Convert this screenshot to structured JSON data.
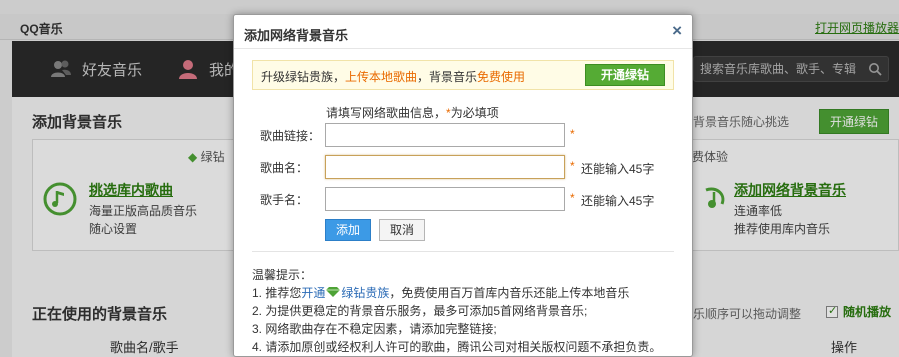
{
  "app": {
    "title": "QQ音乐",
    "open_web_link": "打开网页播放器"
  },
  "nav": {
    "friends": "好友音乐",
    "mine": "我的",
    "search_placeholder": "搜索音乐库歌曲、歌手、专辑"
  },
  "main": {
    "section_title": "添加背景音乐",
    "section_tip": "乐，背景音乐随心挑选",
    "open_green_small": "开通绿钻",
    "card_left": {
      "ribbon": "绿钻",
      "heading": "挑选库内歌曲",
      "line1": "海量正版高品质音乐",
      "line2": "随心设置"
    },
    "card_right": {
      "ribbon": "费体验",
      "heading": "添加网络背景音乐",
      "line1": "连通率低",
      "line2": "推荐使用库内音乐"
    },
    "section_title_2": "正在使用的背景音乐",
    "drag_tip": "乐顺序可以拖动调整",
    "random_play": "随机播放",
    "col_name": "歌曲名/歌手",
    "col_op": "操作"
  },
  "dialog": {
    "title": "添加网络背景音乐",
    "close": "×",
    "promo": {
      "part1": "升级绿钻贵族，",
      "part2": "上传本地歌曲",
      "part3": "，背景音乐",
      "part4": "免费使用",
      "button": "开通绿钻"
    },
    "form": {
      "intro_prefix": "请填写网络歌曲信息，",
      "intro_star": "*",
      "intro_suffix": "为必填项",
      "link_label": "歌曲链接：",
      "link_value": "",
      "link_req": "*",
      "song_label": "歌曲名：",
      "song_value": "",
      "song_req": "*",
      "song_hint": "还能输入45字",
      "singer_label": "歌手名：",
      "singer_value": "",
      "singer_req": "*",
      "singer_hint": "还能输入45字",
      "add_button": "添加",
      "cancel_button": "取消"
    },
    "tips": {
      "title": "温馨提示：",
      "t1_prefix": "1. 推荐您",
      "t1_link1": "开通",
      "t1_link2": "绿钻贵族",
      "t1_suffix": "，免费使用百万首库内音乐还能上传本地音乐",
      "t2": "2. 为提供更稳定的背景音乐服务，最多可添加5首网络背景音乐;",
      "t3": "3. 网络歌曲存在不稳定因素，请添加完整链接;",
      "t4": "4. 请添加原创或经权利人许可的歌曲，腾讯公司对相关版权问题不承担负责。"
    }
  },
  "colors": {
    "accent_green": "#55ab34",
    "highlight_orange": "#e96a00",
    "primary_blue": "#3c9ae6"
  }
}
